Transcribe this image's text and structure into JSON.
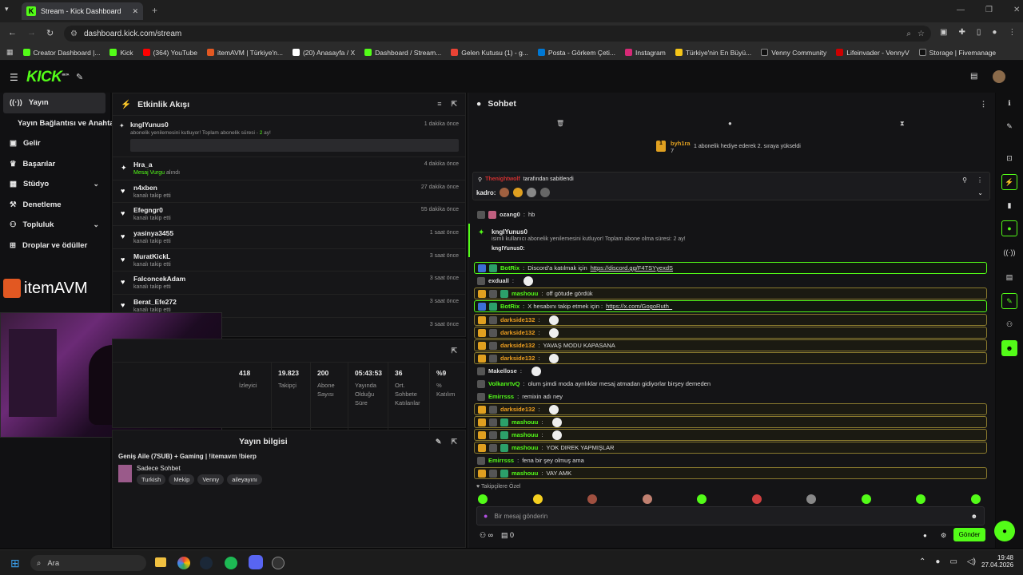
{
  "browser": {
    "tab_title": "Stream - Kick Dashboard",
    "url": "dashboard.kick.com/stream",
    "bookmarks": [
      "Creator Dashboard |...",
      "Kick",
      "(364) YouTube",
      "itemAVM | Türkiye'n...",
      "(20) Anasayfa / X",
      "Dashboard / Stream...",
      "Gelen Kutusu (1) - g...",
      "Posta - Görkem Çeti...",
      "Instagram",
      "Türkiye'nin En Büyü...",
      "Venny Community",
      "Lifeinvader - VennyV",
      "Storage | Fivemanage"
    ]
  },
  "app": {
    "logo": "KICK",
    "logo_badge": "BETA"
  },
  "sidebar": {
    "items": [
      {
        "label": "Yayın",
        "icon": "broadcast-icon"
      },
      {
        "label": "Yayın Bağlantısı ve Anahtarı",
        "icon": ""
      },
      {
        "label": "Gelir",
        "icon": "money-icon"
      },
      {
        "label": "Başarılar",
        "icon": "trophy-icon"
      },
      {
        "label": "Stüdyo",
        "icon": "studio-icon"
      },
      {
        "label": "Denetleme",
        "icon": "hammer-icon"
      },
      {
        "label": "Topluluk",
        "icon": "community-icon"
      },
      {
        "label": "Droplar ve ödüller",
        "icon": "gift-icon"
      }
    ]
  },
  "overlay": {
    "itemavm": "itemAVM"
  },
  "activity": {
    "title": "Etkinlik Akışı",
    "first": {
      "name": "kngIYunus0",
      "sub_pre": "abonelik yenilemesini kutluyor! Toplam abonelik süresi - ",
      "sub_num": "2",
      "sub_post": " ay!",
      "time": "1 dakika önce"
    },
    "rows": [
      {
        "name": "Hra_a",
        "sub1": "Mesaj Vurgu",
        "sub2": " alındı",
        "time": "4 dakika önce"
      },
      {
        "name": "n4xben",
        "sub1": "",
        "sub2": "kanalı takip etti",
        "time": "27 dakika önce"
      },
      {
        "name": "Efegngr0",
        "sub1": "",
        "sub2": "kanalı takip etti",
        "time": "55 dakika önce"
      },
      {
        "name": "yasinya3455",
        "sub1": "",
        "sub2": "kanalı takip etti",
        "time": "1 saat önce"
      },
      {
        "name": "MuratKickL",
        "sub1": "",
        "sub2": "kanalı takip etti",
        "time": "3 saat önce"
      },
      {
        "name": "FalconcekAdam",
        "sub1": "",
        "sub2": "kanalı takip etti",
        "time": "3 saat önce"
      },
      {
        "name": "Berat_Efe272",
        "sub1": "",
        "sub2": "kanalı takip etti",
        "time": "3 saat önce"
      }
    ],
    "last_time": "3 saat önce"
  },
  "stats": [
    {
      "value": "418",
      "label": "İzleyici"
    },
    {
      "value": "19.823",
      "label": "Takipçi"
    },
    {
      "value": "200",
      "label": "Abone Sayısı"
    },
    {
      "value": "05:43:53",
      "label": "Yayında Olduğu Süre"
    },
    {
      "value": "36",
      "label": "Ort. Sohbete Katılanlar"
    },
    {
      "value": "%9",
      "label": "% Katılım"
    }
  ],
  "stream_info": {
    "title": "Yayın bilgisi",
    "stream_title": "Geniş Aile (7SUB) + Gaming | !itemavm !bierp",
    "category": "Sadece Sohbet",
    "tags": [
      "Turkish",
      "Mekip",
      "Venny",
      "aileyayını"
    ]
  },
  "chat": {
    "title": "Sohbet",
    "gift": {
      "user": "byh1ra",
      "count": "7",
      "text": "1 abonelik hediye ederek 2. sıraya yükseldi"
    },
    "pinned": {
      "by": "Thenightwolf",
      "text": "tarafından sabitlendi",
      "kadro": "kadro:"
    },
    "pre_msg": {
      "user": "ozang0",
      "text": "hb"
    },
    "resub": {
      "user": "kngIYunus0",
      "text": "isimli kullanıcı abonelik yenilemesini kutluyor! Toplam abone olma süresi: 2 ay!",
      "reply": "kngIYunus0:"
    },
    "messages": [
      {
        "user": "BotRix",
        "text": "Discord'a katılmak için ",
        "link": "https://discord.gg/F4TSYyexdS",
        "style": "gr",
        "uc": "gr2"
      },
      {
        "user": "exduall",
        "text": "",
        "link": "",
        "style": "",
        "uc": ""
      },
      {
        "user": "mashouu",
        "text": "off götude gördük",
        "link": "",
        "style": "hl",
        "uc": "gr2"
      },
      {
        "user": "BotRix",
        "text": "X hesabını takip etmek için : ",
        "link": "https://x.com/GogoRuth_",
        "style": "gr",
        "uc": "gr2"
      },
      {
        "user": "darkside132",
        "text": "",
        "link": "",
        "style": "hl",
        "uc": "cr"
      },
      {
        "user": "darkside132",
        "text": "",
        "link": "",
        "style": "hl",
        "uc": "cr"
      },
      {
        "user": "darkside132",
        "text": "YAVAŞ MODU KAPASANA",
        "link": "",
        "style": "hl",
        "uc": "cr"
      },
      {
        "user": "darkside132",
        "text": "",
        "link": "",
        "style": "hl",
        "uc": "cr"
      },
      {
        "user": "Makellose",
        "text": "",
        "link": "",
        "style": "",
        "uc": ""
      },
      {
        "user": "VolkanrtvQ",
        "text": "olum şimdi moda ayrılıklar mesaj atmadan gidiyorlar birşey demeden",
        "link": "",
        "style": "",
        "uc": "gr2"
      },
      {
        "user": "Emirrsss",
        "text": "remixin adı ney",
        "link": "",
        "style": "",
        "uc": "gr2"
      },
      {
        "user": "darkside132",
        "text": "",
        "link": "",
        "style": "hl",
        "uc": "cr"
      },
      {
        "user": "mashouu",
        "text": "",
        "link": "",
        "style": "hl",
        "uc": "gr2"
      },
      {
        "user": "mashouu",
        "text": "",
        "link": "",
        "style": "hl",
        "uc": "gr2"
      },
      {
        "user": "mashouu",
        "text": "YOK DIREK YAPMIŞLAR",
        "link": "",
        "style": "hl",
        "uc": "gr2"
      },
      {
        "user": "Emirrsss",
        "text": "fena bir şey olmuş ama",
        "link": "",
        "style": "",
        "uc": "gr2"
      },
      {
        "user": "mashouu",
        "text": "VAY AMK",
        "link": "",
        "style": "hl",
        "uc": "gr2"
      }
    ],
    "emote_label": "Takipçilere Özel",
    "input_placeholder": "Bir mesaj gönderin",
    "points": "∞",
    "count": "0",
    "send": "Gönder"
  },
  "taskbar": {
    "search": "Ara",
    "time": "19:48",
    "date": "27.04.2026"
  }
}
